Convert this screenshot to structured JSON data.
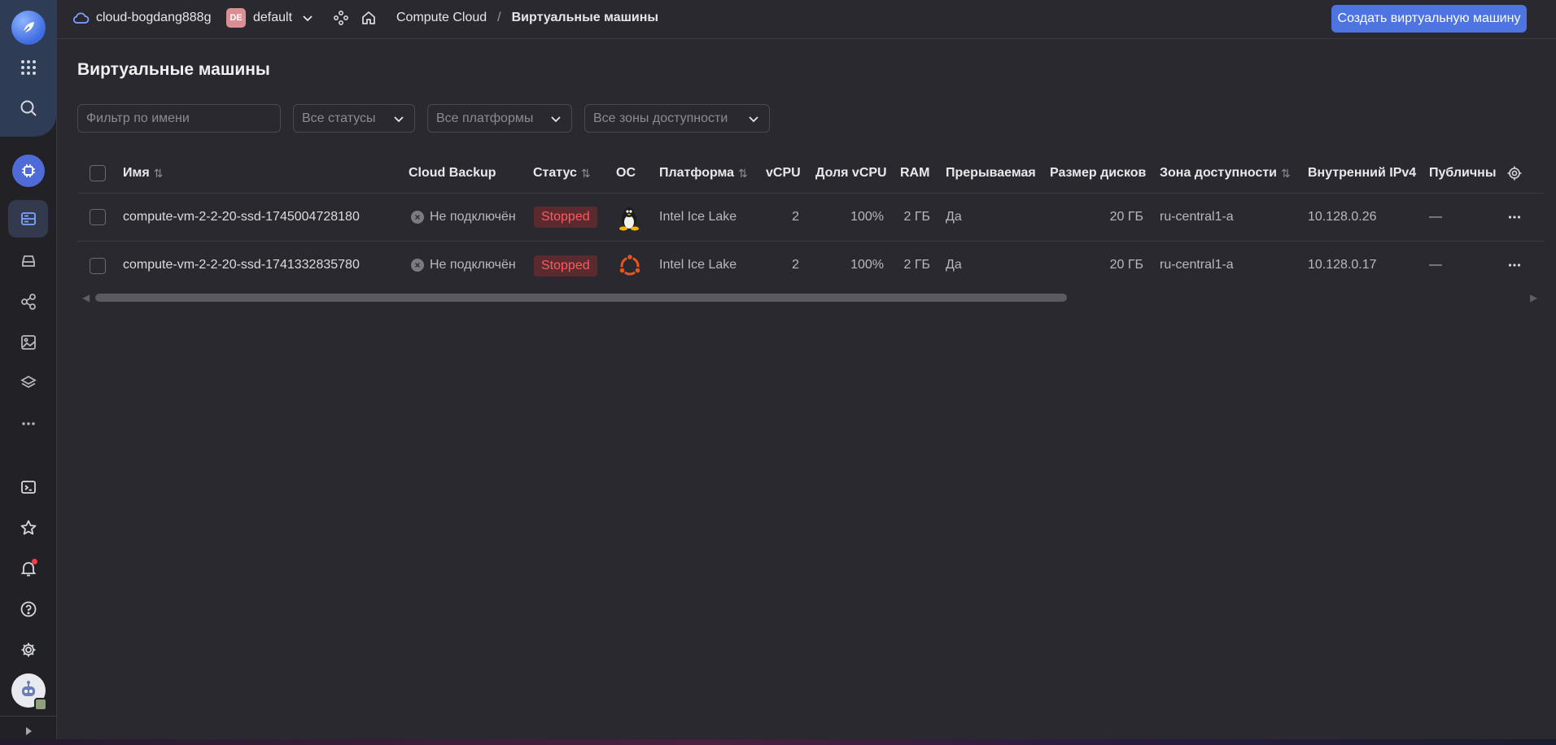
{
  "topbar": {
    "cloud_name": "cloud-bogdang888g",
    "folder_badge": "DE",
    "folder_name": "default",
    "breadcrumb_service": "Compute Cloud",
    "breadcrumb_sep": "/",
    "breadcrumb_page": "Виртуальные машины",
    "create_button": "Создать виртуальную машину"
  },
  "page": {
    "title": "Виртуальные машины"
  },
  "filters": {
    "name_placeholder": "Фильтр по имени",
    "status": "Все статусы",
    "platform": "Все платформы",
    "zone": "Все зоны доступности"
  },
  "table": {
    "headers": {
      "name": "Имя",
      "backup": "Cloud Backup",
      "status": "Статус",
      "os": "ОС",
      "platform": "Платформа",
      "vcpu": "vCPU",
      "vcpu_share": "Доля vCPU",
      "ram": "RAM",
      "preemptible": "Прерываемая",
      "disk_size": "Размер дисков",
      "zone": "Зона доступности",
      "ipv4": "Внутренний IPv4",
      "public": "Публичны"
    },
    "rows": [
      {
        "name": "compute-vm-2-2-20-ssd-1745004728180",
        "backup": "Не подключён",
        "status": "Stopped",
        "os_icon": "linux-tux-icon",
        "platform": "Intel Ice Lake",
        "vcpu": "2",
        "vcpu_share": "100%",
        "ram": "2 ГБ",
        "preemptible": "Да",
        "disk_size": "20 ГБ",
        "zone": "ru-central1-a",
        "ipv4": "10.128.0.26",
        "public": "—"
      },
      {
        "name": "compute-vm-2-2-20-ssd-1741332835780",
        "backup": "Не подключён",
        "status": "Stopped",
        "os_icon": "ubuntu-icon",
        "platform": "Intel Ice Lake",
        "vcpu": "2",
        "vcpu_share": "100%",
        "ram": "2 ГБ",
        "preemptible": "Да",
        "disk_size": "20 ГБ",
        "zone": "ru-central1-a",
        "ipv4": "10.128.0.17",
        "public": "—"
      }
    ]
  },
  "colors": {
    "accent": "#4d74e0",
    "status_stopped_text": "#ff5a60",
    "status_stopped_bg": "#5a2a2e",
    "ubuntu": "#e95420"
  }
}
